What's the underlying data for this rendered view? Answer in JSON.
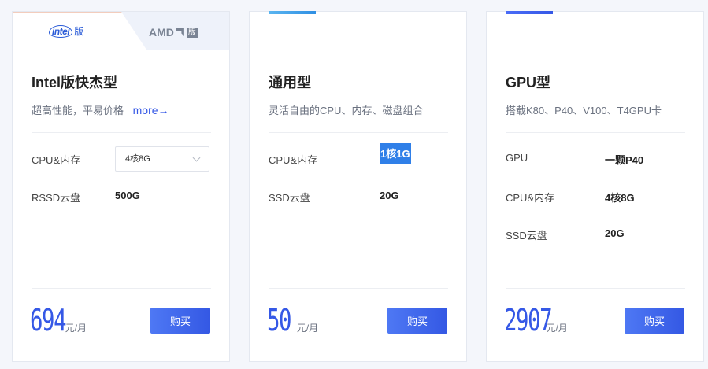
{
  "colors": {
    "accent": "#3558e6",
    "highlight": "#2f7fe8",
    "card_bg": "#ffffff",
    "page_bg": "#f4f6fb"
  },
  "cards": [
    {
      "tabs": {
        "intel_label": "intel",
        "intel_suffix": "版",
        "amd_label": "AMD",
        "amd_suffix": "版"
      },
      "title": "Intel版快杰型",
      "subtitle": "超高性能，平易价格",
      "more_link": "more→",
      "specs": [
        {
          "label": "CPU&内存",
          "value": "4核8G",
          "type": "select"
        },
        {
          "label": "RSSD云盘",
          "value": "500G"
        }
      ],
      "price": "694",
      "price_unit": "元/月",
      "buy_label": "购买"
    },
    {
      "title": "通用型",
      "subtitle": "灵活自由的CPU、内存、磁盘组合",
      "specs": [
        {
          "label": "CPU&内存",
          "value": "1核1G",
          "highlighted": true
        },
        {
          "label": "SSD云盘",
          "value": "20G"
        }
      ],
      "price": "50",
      "price_unit": "元/月",
      "buy_label": "购买"
    },
    {
      "title": "GPU型",
      "subtitle": "搭载K80、P40、V100、T4GPU卡",
      "specs": [
        {
          "label": "GPU",
          "value": "一颗P40"
        },
        {
          "label": "CPU&内存",
          "value": "4核8G"
        },
        {
          "label": "SSD云盘",
          "value": "20G"
        }
      ],
      "price": "2907",
      "price_unit": "元/月",
      "buy_label": "购买"
    }
  ]
}
